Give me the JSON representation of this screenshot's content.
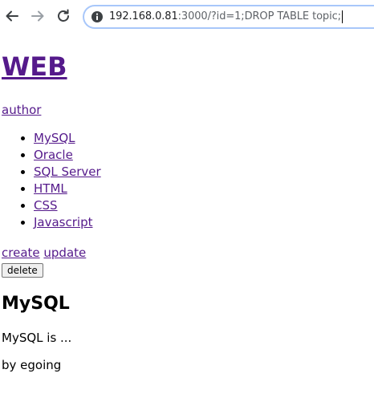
{
  "browser": {
    "url_host": "192.168.0.81",
    "url_rest": ":3000/?id=1;DROP TABLE topic;",
    "accent_color": "#a8c7fa"
  },
  "page": {
    "title": "WEB",
    "author_link": "author",
    "topics": [
      "MySQL",
      "Oracle",
      "SQL Server",
      "HTML",
      "CSS",
      "Javascript"
    ],
    "create_link": "create",
    "update_link": "update",
    "delete_button": "delete",
    "topic_title": "MySQL",
    "description": "MySQL is ...",
    "byline": "by egoing",
    "link_color": "#551a8b"
  }
}
